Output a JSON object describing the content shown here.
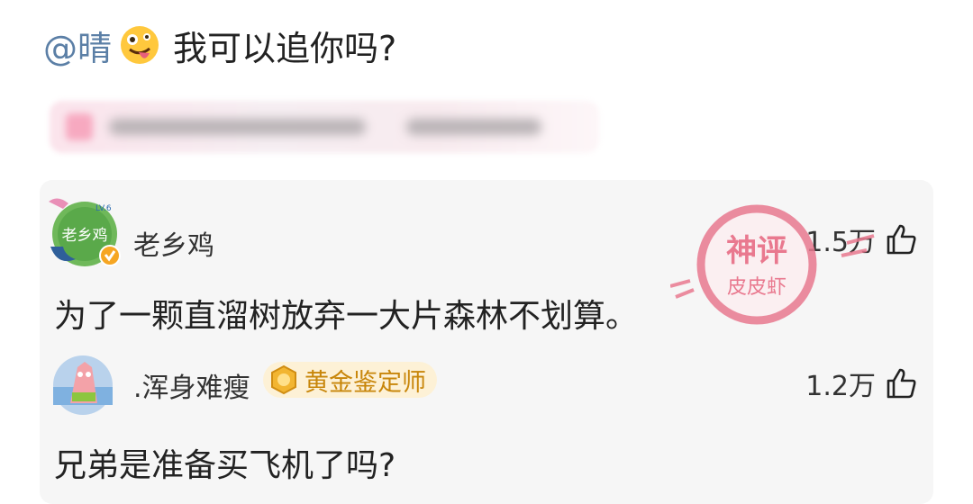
{
  "post": {
    "mention": "@晴",
    "emoji": "zany-face-emoji",
    "text": "我可以追你吗?"
  },
  "comments": [
    {
      "username": "老乡鸡",
      "avatar_text": "老乡鸡",
      "avatar_level": "LV.6",
      "likes": "1.5万",
      "text": "为了一颗直溜树放弃一大片森林不划算。",
      "verified": true
    },
    {
      "username": ".浑身难瘦",
      "badge": "黄金鉴定师",
      "likes": "1.2万",
      "text": "兄弟是准备买飞机了吗?"
    }
  ],
  "stamp": {
    "line1": "神评",
    "line2": "皮皮虾"
  },
  "colors": {
    "mention": "#5b7fa6",
    "badge_bg": "#fdf1d6",
    "badge_text": "#c8860a",
    "stamp": "#e9798f",
    "panel_bg": "#f6f6f6"
  }
}
